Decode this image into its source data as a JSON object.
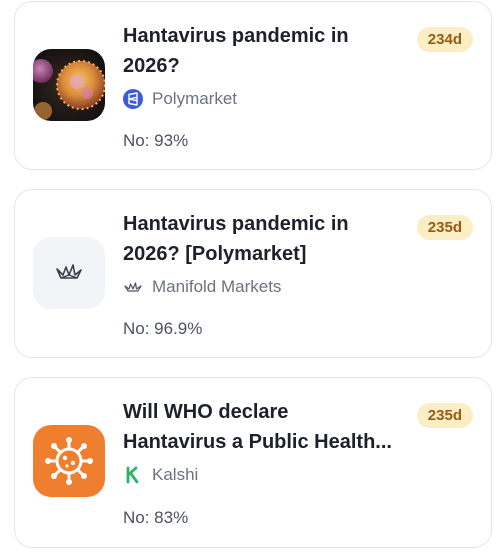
{
  "cards": [
    {
      "title": "Hantavirus pandemic in\n2026?",
      "days": "234d",
      "source": "Polymarket",
      "source_icon": "polymarket-icon",
      "answer": "No: 93%",
      "thumb": "virus-photo"
    },
    {
      "title": "Hantavirus pandemic in\n2026? [Polymarket]",
      "days": "235d",
      "source": "Manifold Markets",
      "source_icon": "manifold-crane-icon",
      "answer": "No: 96.9%",
      "thumb": "manifold-logo"
    },
    {
      "title": "Will WHO declare\nHantavirus a Public Health...",
      "days": "235d",
      "source": "Kalshi",
      "source_icon": "kalshi-k-icon",
      "answer": "No: 83%",
      "thumb": "virus-icon"
    }
  ],
  "colors": {
    "badge_bg": "#fbedc4",
    "badge_text": "#9a5a12",
    "kalshi_green": "#2fb36a",
    "polymarket_blue": "#3b5bdb",
    "virus_orange": "#f07e2f"
  }
}
